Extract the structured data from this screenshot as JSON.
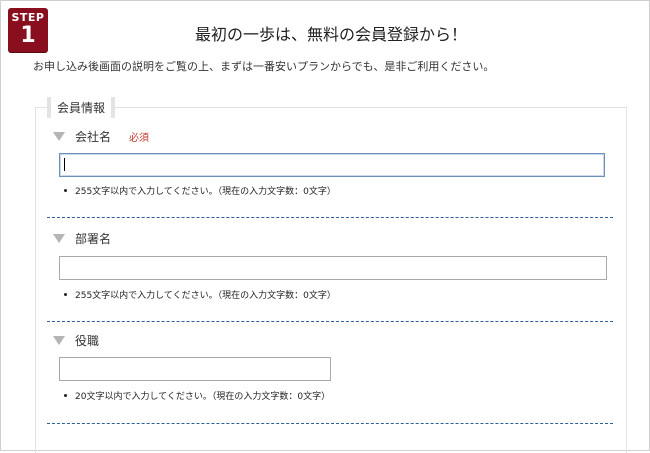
{
  "step": {
    "label": "STEP",
    "number": "1"
  },
  "header": {
    "title": "最初の一歩は、無料の会員登録から！",
    "subtitle": "お申し込み後画面の説明をご覧の上、まずは一番安いプランからでも、是非ご利用ください。"
  },
  "section": {
    "legend": "会員情報"
  },
  "fields": [
    {
      "label": "会社名",
      "required": "必須",
      "value": "",
      "hint": "255文字以内で入力してください。（現在の入力文字数：0文字）"
    },
    {
      "label": "部署名",
      "value": "",
      "hint": "255文字以内で入力してください。（現在の入力文字数：0文字）"
    },
    {
      "label": "役職",
      "value": "",
      "hint": "20文字以内で入力してください。（現在の入力文字数：0文字）"
    }
  ]
}
